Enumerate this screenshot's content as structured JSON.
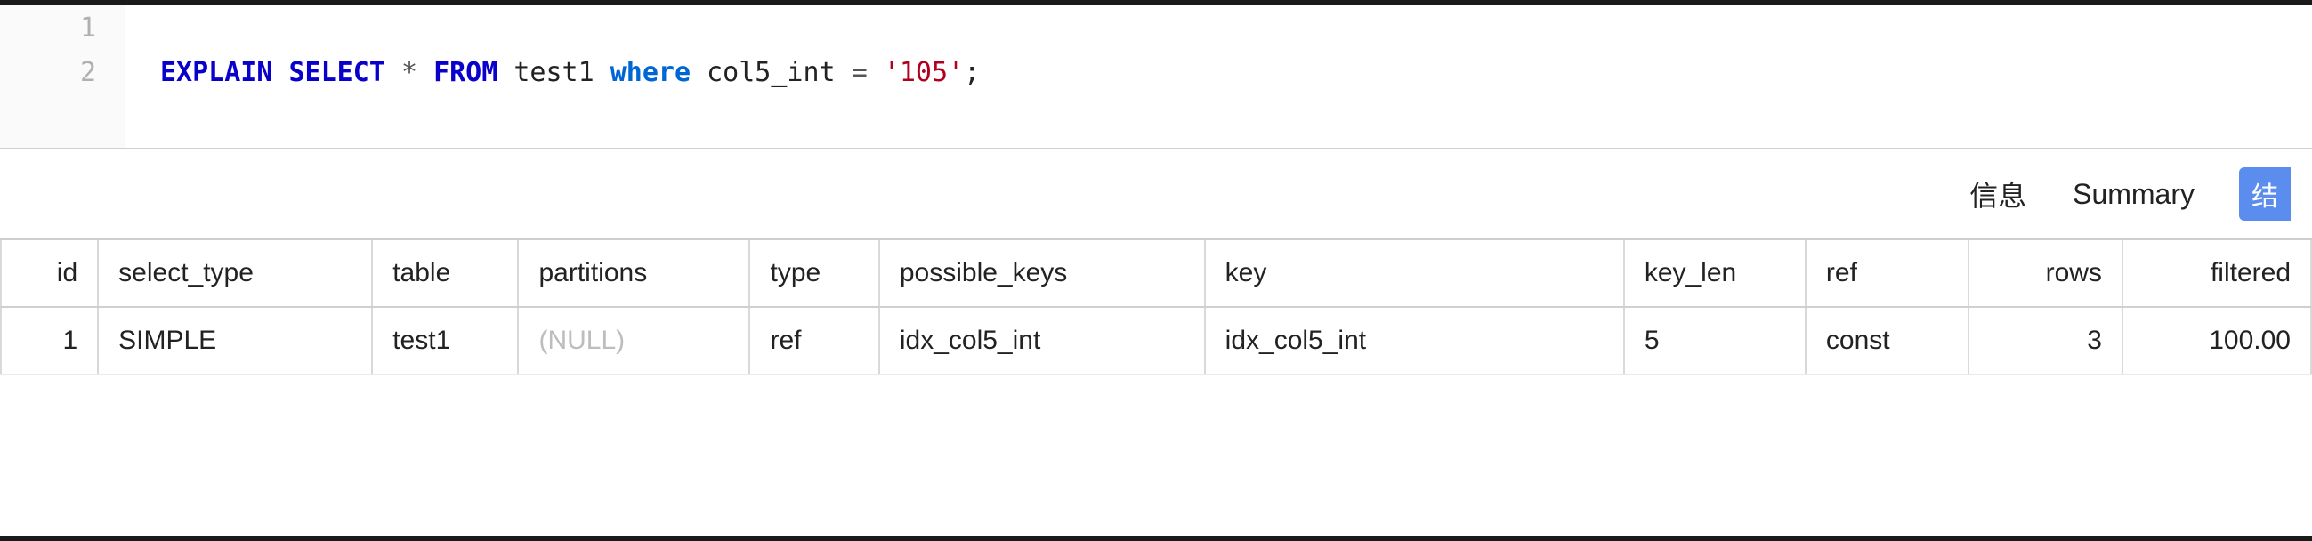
{
  "editor": {
    "lines": [
      {
        "num": "1",
        "tokens": []
      },
      {
        "num": "2",
        "tokens": [
          {
            "cls": "kw",
            "t": "EXPLAIN "
          },
          {
            "cls": "kw",
            "t": "SELECT "
          },
          {
            "cls": "op",
            "t": "* "
          },
          {
            "cls": "kw",
            "t": "FROM "
          },
          {
            "cls": "ident",
            "t": "test1 "
          },
          {
            "cls": "kw2",
            "t": "where "
          },
          {
            "cls": "ident",
            "t": "col5_int "
          },
          {
            "cls": "op",
            "t": "= "
          },
          {
            "cls": "str",
            "t": "'105'"
          },
          {
            "cls": "punct",
            "t": ";"
          }
        ]
      }
    ]
  },
  "tabs": {
    "info": "信息",
    "summary": "Summary",
    "results_partial": "结"
  },
  "table": {
    "columns": [
      "id",
      "select_type",
      "table",
      "partitions",
      "type",
      "possible_keys",
      "key",
      "key_len",
      "ref",
      "rows",
      "filtered"
    ],
    "rows": [
      {
        "id": "1",
        "select_type": "SIMPLE",
        "table": "test1",
        "partitions": "(NULL)",
        "type": "ref",
        "possible_keys": "idx_col5_int",
        "key": "idx_col5_int",
        "key_len": "5",
        "ref": "const",
        "rows": "3",
        "filtered": "100.00"
      }
    ]
  }
}
